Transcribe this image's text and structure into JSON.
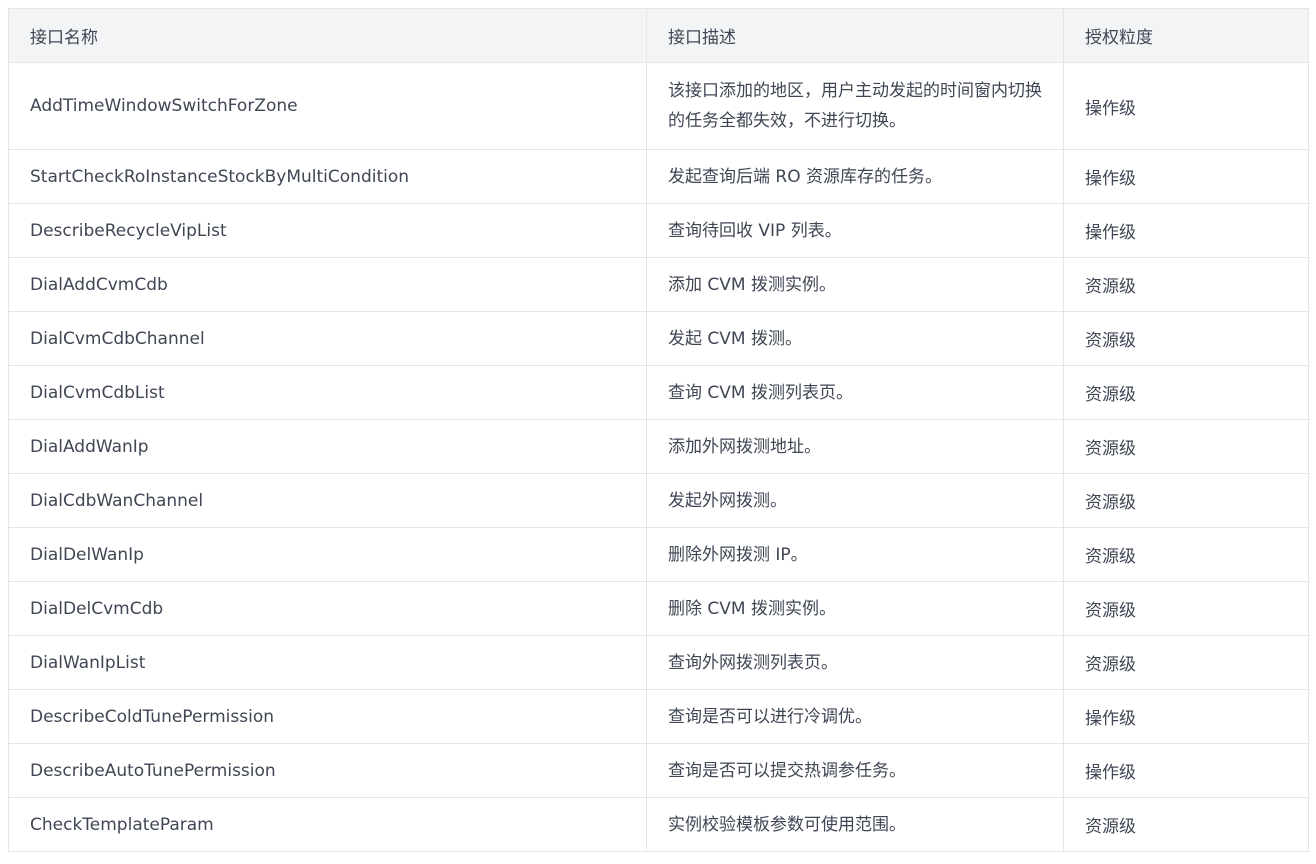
{
  "table": {
    "headers": [
      "接口名称",
      "接口描述",
      "授权粒度"
    ],
    "rows": [
      {
        "name": "AddTimeWindowSwitchForZone",
        "desc": "该接口添加的地区，用户主动发起的时间窗内切换的任务全都失效，不进行切换。",
        "level": "操作级"
      },
      {
        "name": "StartCheckRoInstanceStockByMultiCondition",
        "desc": "发起查询后端 RO 资源库存的任务。",
        "level": "操作级"
      },
      {
        "name": "DescribeRecycleVipList",
        "desc": "查询待回收 VIP 列表。",
        "level": "操作级"
      },
      {
        "name": "DialAddCvmCdb",
        "desc": "添加 CVM 拨测实例。",
        "level": "资源级"
      },
      {
        "name": "DialCvmCdbChannel",
        "desc": "发起 CVM 拨测。",
        "level": "资源级"
      },
      {
        "name": "DialCvmCdbList",
        "desc": "查询 CVM 拨测列表页。",
        "level": "资源级"
      },
      {
        "name": "DialAddWanIp",
        "desc": "添加外网拨测地址。",
        "level": "资源级"
      },
      {
        "name": "DialCdbWanChannel",
        "desc": "发起外网拨测。",
        "level": "资源级"
      },
      {
        "name": "DialDelWanIp",
        "desc": "删除外网拨测 IP。",
        "level": "资源级"
      },
      {
        "name": "DialDelCvmCdb",
        "desc": "删除 CVM 拨测实例。",
        "level": "资源级"
      },
      {
        "name": "DialWanIpList",
        "desc": "查询外网拨测列表页。",
        "level": "资源级"
      },
      {
        "name": "DescribeColdTunePermission",
        "desc": "查询是否可以进行冷调优。",
        "level": "操作级"
      },
      {
        "name": "DescribeAutoTunePermission",
        "desc": "查询是否可以提交热调参任务。",
        "level": "操作级"
      },
      {
        "name": "CheckTemplateParam",
        "desc": "实例校验模板参数可使用范围。",
        "level": "资源级"
      }
    ]
  }
}
